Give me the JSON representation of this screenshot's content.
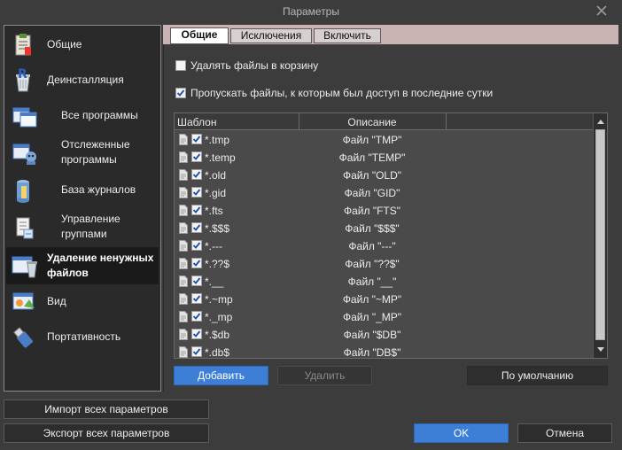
{
  "window": {
    "title": "Параметры",
    "close_icon": "close-icon"
  },
  "sidebar": {
    "items": [
      {
        "label": "Общие",
        "icon": "clipboard-icon",
        "active": false
      },
      {
        "label": "Деинсталляция",
        "icon": "recycle-bin-icon",
        "active": false
      },
      {
        "label": "Все программы",
        "icon": "windows-icon",
        "active": false
      },
      {
        "label": "Отслеженные программы",
        "icon": "monitored-apps-icon",
        "active": false
      },
      {
        "label": "База журналов",
        "icon": "database-icon",
        "active": false
      },
      {
        "label": "Управление группами",
        "icon": "group-document-icon",
        "active": false
      },
      {
        "label": "Удаление ненужных файлов",
        "icon": "junk-cleanup-icon",
        "active": true
      },
      {
        "label": "Вид",
        "icon": "appearance-icon",
        "active": false
      },
      {
        "label": "Портативность",
        "icon": "usb-drive-icon",
        "active": false
      }
    ]
  },
  "tabs": [
    {
      "label": "Общие",
      "active": true
    },
    {
      "label": "Исключения",
      "active": false
    },
    {
      "label": "Включить",
      "active": false
    }
  ],
  "options": {
    "recycle_bin": {
      "label": "Удалять файлы в корзину",
      "checked": false
    },
    "skip_recent": {
      "label": "Пропускать файлы, к которым был доступ в последние сутки",
      "checked": true
    }
  },
  "list": {
    "columns": [
      "Шаблон",
      "Описание"
    ],
    "rows": [
      {
        "pattern": "*.tmp",
        "description": "Файл \"TMP\"",
        "checked": true
      },
      {
        "pattern": "*.temp",
        "description": "Файл \"TEMP\"",
        "checked": true
      },
      {
        "pattern": "*.old",
        "description": "Файл \"OLD\"",
        "checked": true
      },
      {
        "pattern": "*.gid",
        "description": "Файл \"GID\"",
        "checked": true
      },
      {
        "pattern": "*.fts",
        "description": "Файл \"FTS\"",
        "checked": true
      },
      {
        "pattern": "*.$$$",
        "description": "Файл \"$$$\"",
        "checked": true
      },
      {
        "pattern": "*.---",
        "description": "Файл \"---\"",
        "checked": true
      },
      {
        "pattern": "*.??$",
        "description": "Файл \"??$\"",
        "checked": true
      },
      {
        "pattern": "*.__",
        "description": "Файл \"__\"",
        "checked": true
      },
      {
        "pattern": "*.~mp",
        "description": "Файл \"~MP\"",
        "checked": true
      },
      {
        "pattern": "*._mp",
        "description": "Файл \"_MP\"",
        "checked": true
      },
      {
        "pattern": "*.$db",
        "description": "Файл \"$DB\"",
        "checked": true
      },
      {
        "pattern": "*.db$",
        "description": "Файл \"DB$\"",
        "checked": true
      }
    ]
  },
  "actions": {
    "add": "Добавить",
    "remove": "Удалить",
    "defaults": "По умолчанию"
  },
  "footer": {
    "import": "Импорт всех параметров",
    "export": "Экспорт всех параметров",
    "ok": "OK",
    "cancel": "Отмена"
  },
  "colors": {
    "accent": "#3d7fd6",
    "tab_strip": "#c9b3b3",
    "background": "#3c3c3c",
    "sidebar": "#2a2a2a"
  }
}
